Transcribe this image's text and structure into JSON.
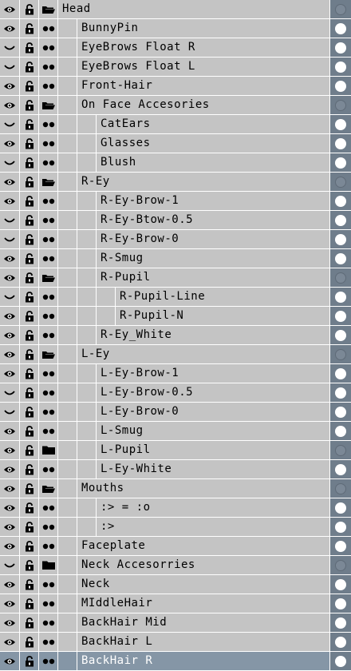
{
  "layers": [
    {
      "label": "Head",
      "depth": 0,
      "type": "folder-open",
      "eye": "visible",
      "group": true,
      "selected": false
    },
    {
      "label": "BunnyPin",
      "depth": 1,
      "type": "layer",
      "eye": "visible",
      "group": false,
      "selected": false
    },
    {
      "label": "EyeBrows Float R",
      "depth": 1,
      "type": "layer",
      "eye": "hidden",
      "group": false,
      "selected": false
    },
    {
      "label": "EyeBrows Float L",
      "depth": 1,
      "type": "layer",
      "eye": "hidden",
      "group": false,
      "selected": false
    },
    {
      "label": "Front-Hair",
      "depth": 1,
      "type": "layer",
      "eye": "visible",
      "group": false,
      "selected": false
    },
    {
      "label": "On Face Accesories",
      "depth": 1,
      "type": "folder-open",
      "eye": "visible",
      "group": true,
      "selected": false
    },
    {
      "label": "CatEars",
      "depth": 2,
      "type": "layer",
      "eye": "hidden",
      "group": false,
      "selected": false
    },
    {
      "label": "Glasses",
      "depth": 2,
      "type": "layer",
      "eye": "visible",
      "group": false,
      "selected": false
    },
    {
      "label": "Blush",
      "depth": 2,
      "type": "layer",
      "eye": "hidden",
      "group": false,
      "selected": false
    },
    {
      "label": "R-Ey",
      "depth": 1,
      "type": "folder-open",
      "eye": "visible",
      "group": true,
      "selected": false
    },
    {
      "label": "R-Ey-Brow-1",
      "depth": 2,
      "type": "layer",
      "eye": "visible",
      "group": false,
      "selected": false
    },
    {
      "label": "R-Ey-Btow-0.5",
      "depth": 2,
      "type": "layer",
      "eye": "hidden",
      "group": false,
      "selected": false
    },
    {
      "label": "R-Ey-Brow-0",
      "depth": 2,
      "type": "layer",
      "eye": "hidden",
      "group": false,
      "selected": false
    },
    {
      "label": "R-Smug",
      "depth": 2,
      "type": "layer",
      "eye": "visible",
      "group": false,
      "selected": false
    },
    {
      "label": "R-Pupil",
      "depth": 2,
      "type": "folder-open",
      "eye": "visible",
      "group": true,
      "selected": false
    },
    {
      "label": "R-Pupil-Line",
      "depth": 3,
      "type": "layer",
      "eye": "hidden",
      "group": false,
      "selected": false
    },
    {
      "label": "R-Pupil-N",
      "depth": 3,
      "type": "layer",
      "eye": "visible",
      "group": false,
      "selected": false
    },
    {
      "label": "R-Ey_White",
      "depth": 2,
      "type": "layer",
      "eye": "visible",
      "group": false,
      "selected": false
    },
    {
      "label": "L-Ey",
      "depth": 1,
      "type": "folder-open",
      "eye": "visible",
      "group": true,
      "selected": false
    },
    {
      "label": "L-Ey-Brow-1",
      "depth": 2,
      "type": "layer",
      "eye": "visible",
      "group": false,
      "selected": false
    },
    {
      "label": "L-Ey-Brow-0.5",
      "depth": 2,
      "type": "layer",
      "eye": "hidden",
      "group": false,
      "selected": false
    },
    {
      "label": "L-Ey-Brow-0",
      "depth": 2,
      "type": "layer",
      "eye": "hidden",
      "group": false,
      "selected": false
    },
    {
      "label": "L-Smug",
      "depth": 2,
      "type": "layer",
      "eye": "visible",
      "group": false,
      "selected": false
    },
    {
      "label": "L-Pupil",
      "depth": 2,
      "type": "folder-closed",
      "eye": "visible",
      "group": true,
      "selected": false
    },
    {
      "label": "L-Ey-White",
      "depth": 2,
      "type": "layer",
      "eye": "visible",
      "group": false,
      "selected": false
    },
    {
      "label": "Mouths",
      "depth": 1,
      "type": "folder-open",
      "eye": "visible",
      "group": true,
      "selected": false
    },
    {
      "label": ":> = :o",
      "depth": 2,
      "type": "layer",
      "eye": "visible",
      "group": false,
      "selected": false
    },
    {
      "label": ":>",
      "depth": 2,
      "type": "layer",
      "eye": "visible",
      "group": false,
      "selected": false
    },
    {
      "label": "Faceplate",
      "depth": 1,
      "type": "layer",
      "eye": "visible",
      "group": false,
      "selected": false
    },
    {
      "label": "Neck Accesorries",
      "depth": 1,
      "type": "folder-closed",
      "eye": "hidden",
      "group": true,
      "selected": false
    },
    {
      "label": "Neck",
      "depth": 1,
      "type": "layer",
      "eye": "visible",
      "group": false,
      "selected": false
    },
    {
      "label": "MIddleHair",
      "depth": 1,
      "type": "layer",
      "eye": "visible",
      "group": false,
      "selected": false
    },
    {
      "label": "BackHair Mid",
      "depth": 1,
      "type": "layer",
      "eye": "visible",
      "group": false,
      "selected": false
    },
    {
      "label": "BackHair  L",
      "depth": 1,
      "type": "layer",
      "eye": "visible",
      "group": false,
      "selected": false
    },
    {
      "label": "BackHair R",
      "depth": 1,
      "type": "layer",
      "eye": "visible",
      "group": false,
      "selected": true
    }
  ],
  "colors": {
    "row_bg": "#c4c4c4",
    "separator": "#ffffff",
    "radio_column": "#6f7d8b",
    "selected_row": "#8596a6",
    "text": "#000000"
  }
}
